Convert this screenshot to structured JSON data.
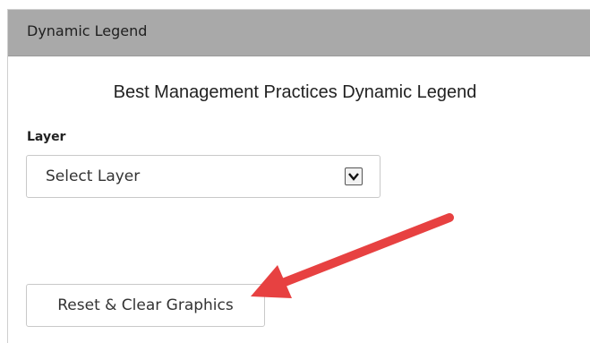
{
  "panel": {
    "title": "Dynamic Legend"
  },
  "legend": {
    "title": "Best Management Practices Dynamic Legend"
  },
  "layer": {
    "label": "Layer",
    "selected": "Select Layer"
  },
  "actions": {
    "reset_label": "Reset & Clear Graphics"
  },
  "colors": {
    "header_bg": "#a9a9a9",
    "annotation_arrow": "#e74141"
  },
  "icons": {
    "dropdown": "chevron-down-icon",
    "annotation": "pointer-arrow-icon"
  }
}
